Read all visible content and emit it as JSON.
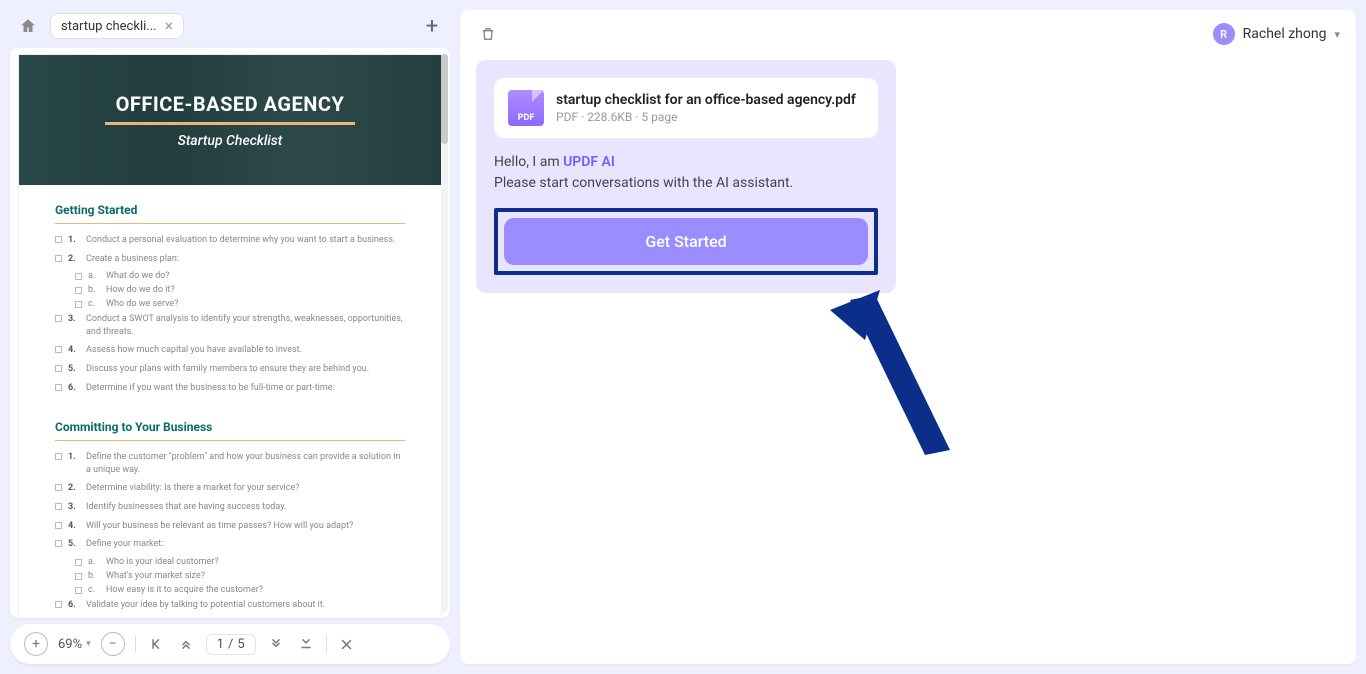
{
  "tabs": {
    "active_label": "startup checkli...",
    "home_icon": "home-icon"
  },
  "doc": {
    "title": "OFFICE-BASED AGENCY",
    "subtitle": "Startup Checklist",
    "page_number": "1",
    "sections": [
      {
        "title": "Getting Started",
        "items": [
          {
            "num": "1.",
            "text": "Conduct a personal evaluation to determine why you want to start a business."
          },
          {
            "num": "2.",
            "text": "Create a business plan:",
            "subs": [
              {
                "letter": "a.",
                "text": "What do we do?"
              },
              {
                "letter": "b.",
                "text": "How do we do it?"
              },
              {
                "letter": "c.",
                "text": "Who do we serve?"
              }
            ]
          },
          {
            "num": "3.",
            "text": "Conduct a SWOT analysis to identify your strengths, weaknesses, opportunities, and threats."
          },
          {
            "num": "4.",
            "text": "Assess how much capital you have available to invest."
          },
          {
            "num": "5.",
            "text": "Discuss your plans with family members to ensure they are behind you."
          },
          {
            "num": "6.",
            "text": "Determine if you want the business to be full-time or part-time."
          }
        ]
      },
      {
        "title": "Committing to Your Business",
        "items": [
          {
            "num": "1.",
            "text": "Define the customer \"problem\" and how your business can provide a solution in a unique way."
          },
          {
            "num": "2.",
            "text": "Determine viability: Is there a market for your service?"
          },
          {
            "num": "3.",
            "text": "Identify businesses that are having success today."
          },
          {
            "num": "4.",
            "text": "Will your business be relevant as time passes? How will you adapt?"
          },
          {
            "num": "5.",
            "text": "Define your market:",
            "subs": [
              {
                "letter": "a.",
                "text": "Who is your ideal customer?"
              },
              {
                "letter": "b.",
                "text": "What's your market size?"
              },
              {
                "letter": "c.",
                "text": "How easy is it to acquire the customer?"
              }
            ]
          },
          {
            "num": "6.",
            "text": "Validate your idea by talking to potential customers about it."
          }
        ]
      }
    ]
  },
  "bottombar": {
    "zoom": "69%",
    "page_current": "1",
    "page_sep": "/",
    "page_total": "5"
  },
  "ai": {
    "file_name": "startup checklist for an office-based agency.pdf",
    "file_meta": "PDF · 228.6KB · 5 page",
    "pdf_label": "PDF",
    "greet_prefix": "Hello, I am ",
    "brand": "UPDF AI",
    "greet_line2": "Please start conversations with the AI assistant.",
    "cta": "Get Started"
  },
  "user": {
    "initial": "R",
    "name": "Rachel zhong"
  }
}
